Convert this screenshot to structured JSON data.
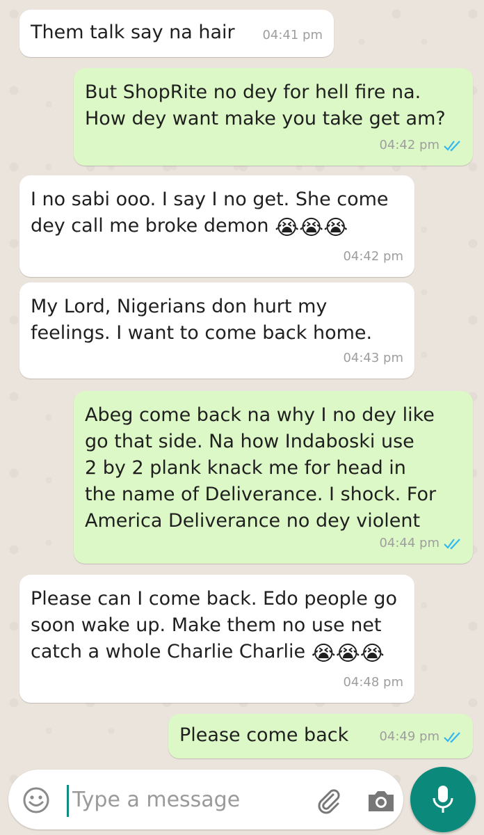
{
  "messages": [
    {
      "dir": "in",
      "text": "Them talk say na hair",
      "time": "04:41 pm"
    },
    {
      "dir": "out",
      "text_lines": [
        "But ShopRite no dey for hell fire na.",
        "How dey want make you take get am?"
      ],
      "time": "04:42 pm",
      "status": "read"
    },
    {
      "dir": "in",
      "text_lines": [
        "I no sabi ooo. I say I no get. She come",
        "dey call me broke demon"
      ],
      "emoji": "😭😭😭",
      "time": "04:42 pm"
    },
    {
      "dir": "in",
      "text_lines": [
        "My Lord, Nigerians don hurt my",
        "feelings. I want to come back home."
      ],
      "time": "04:43 pm"
    },
    {
      "dir": "out",
      "text_lines": [
        "Abeg come back na why I no dey like",
        "go that side. Na how Indaboski use",
        "2 by 2 plank knack me for head in",
        "the name of Deliverance. I shock. For",
        "America Deliverance no dey violent"
      ],
      "time": "04:44 pm",
      "status": "read"
    },
    {
      "dir": "in",
      "text_lines": [
        "Please can I come back. Edo people go",
        "soon wake up. Make them no use net",
        "catch a whole Charlie Charlie"
      ],
      "emoji": "😭😭😭",
      "time": "04:48 pm"
    },
    {
      "dir": "out",
      "text": "Please come back",
      "time": "04:49 pm",
      "status": "read"
    }
  ],
  "composer": {
    "placeholder": "Type a message"
  },
  "colors": {
    "incoming_bubble": "#ffffff",
    "outgoing_bubble": "#dcf8c6",
    "read_ticks": "#34b7f1",
    "accent": "#0b8a7c"
  },
  "icons": [
    "emoji-icon",
    "attach-icon",
    "camera-icon",
    "mic-icon",
    "double-check-icon"
  ]
}
